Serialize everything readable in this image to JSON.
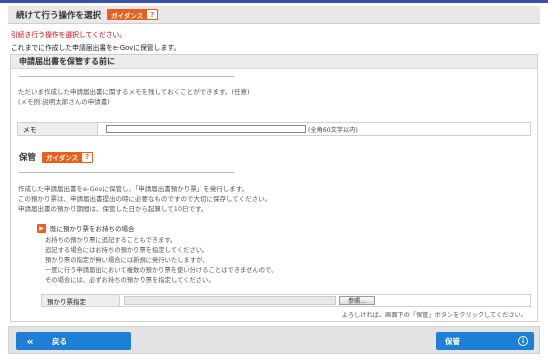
{
  "header": {
    "title": "続けて行う操作を選択",
    "guide_label": "ガイダンス",
    "guide_icon": "?"
  },
  "messages": {
    "error": "引続き行う操作を選択してください。",
    "info": "これまでに作成した申請届出書をe-Govに保管します。"
  },
  "panel": {
    "heading": "申請届出書を保管する前に",
    "desc1_line1": "ただいま作成した申請届出書に関するメモを残しておくことができます。(任意)",
    "desc1_line2": "(メモ例:説明太郎さんの申請書)",
    "memo": {
      "label": "メモ",
      "value": "",
      "hint": "(全角60文字以内)"
    },
    "hokan": {
      "title": "保管",
      "guide_label": "ガイダンス",
      "guide_icon": "?"
    },
    "desc2_line1": "作成した申請届出書をe-Govに保管し、「申請届出書預かり票」を発行します。",
    "desc2_line2": "この預かり票は、申請届出書提出の時に必要なものですので大切に保存してください。",
    "desc2_line3": "申請届出書の預かり期間は、保管した日から起算して10日です。",
    "already": {
      "icon": "arrow-right-icon",
      "label": "既に預かり票をお持ちの場合"
    },
    "desc3_line1": "お持ちの預かり票に追記することもできます。",
    "desc3_line2": "追記する場合にはお持ちの預かり票を指定してください。",
    "desc3_line3": "預かり票の指定が無い場合には新規に発行いたしますが、",
    "desc3_line4": "一度に行う申請届出において複数の預かり票を使い分けることはできませんので、",
    "desc3_line5": "その場合には、必ずお持ちの預かり票を指定してください。",
    "receipt": {
      "label": "預かり票指定",
      "value": "",
      "browse_label": "参照..."
    },
    "footnote": "よろしければ、画面下の「保管」ボタンをクリックしてください。"
  },
  "footer": {
    "back_label": "戻る",
    "back_icon": "«",
    "save_label": "保管",
    "save_icon": "i"
  }
}
